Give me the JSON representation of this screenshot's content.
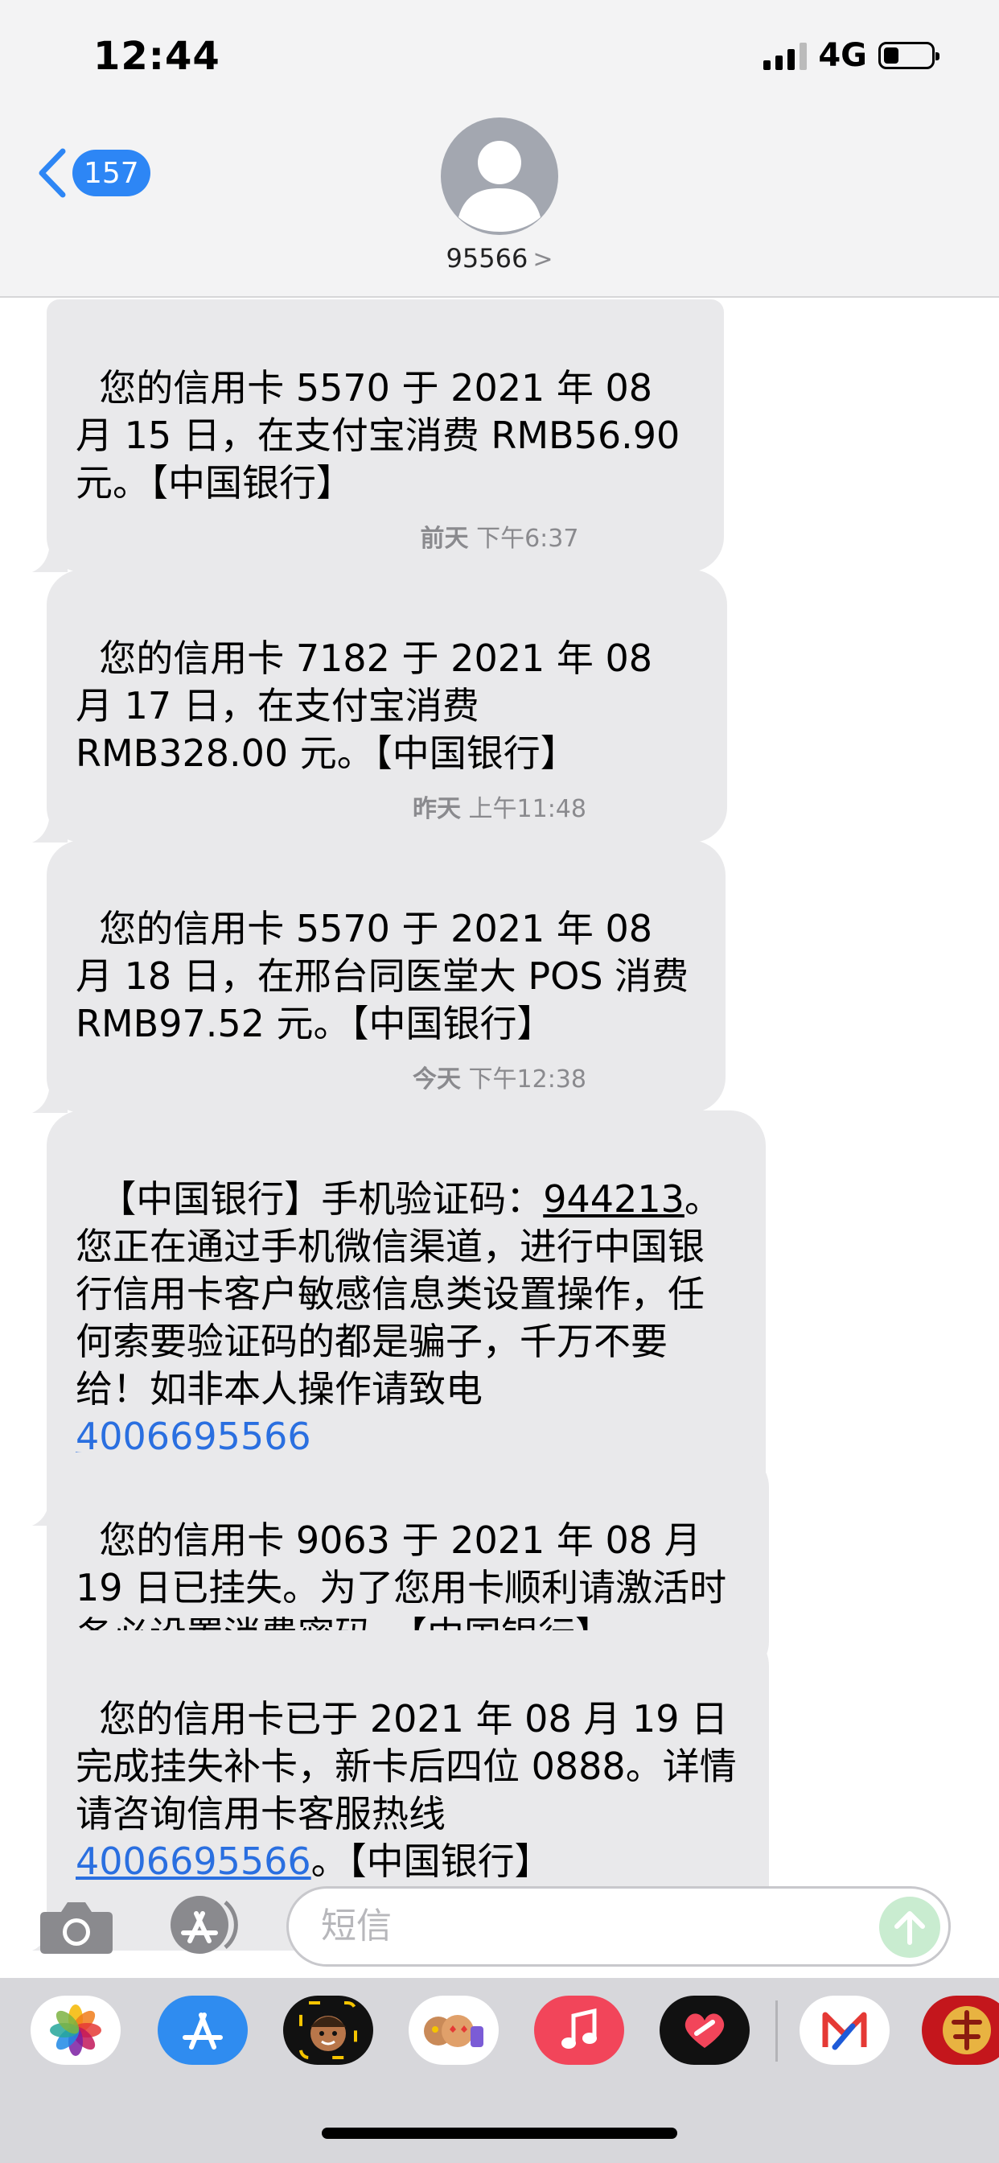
{
  "status": {
    "time": "12:44",
    "network": "4G"
  },
  "header": {
    "unread_count": "157",
    "contact": "95566",
    "contact_chevron": ">"
  },
  "messages": [
    {
      "type": "bubble",
      "text": "您的信用卡 5570 于 2021 年 08 月 15 日，在支付宝消费 RMB56.90 元。【中国银行】"
    },
    {
      "type": "time",
      "day": "前天",
      "time": "下午6:37"
    },
    {
      "type": "bubble",
      "text": "您的信用卡 7182 于 2021 年 08 月 17 日，在支付宝消费 RMB328.00 元。【中国银行】"
    },
    {
      "type": "time",
      "day": "昨天",
      "time": "上午11:48"
    },
    {
      "type": "bubble",
      "text": "您的信用卡 5570 于 2021 年 08 月 18 日，在邢台同医堂大 POS 消费 RMB97.52 元。【中国银行】"
    },
    {
      "type": "time",
      "day": "今天",
      "time": "下午12:38"
    },
    {
      "type": "bubble",
      "pre": "【中国银行】手机验证码：",
      "code": "944213",
      "mid": "。您正在通过手机微信渠道，进行中国银行信用卡客户敏感信息类设置操作，任何索要验证码的都是骗子，千万不要给！如非本人操作请致电",
      "phone": "4006695566"
    },
    {
      "type": "bubble",
      "text": "您的信用卡 9063 于 2021 年 08 月 19 日已挂失。为了您用卡顺利请激活时务必设置消费密码。【中国银行】"
    },
    {
      "type": "bubble",
      "pre": "您的信用卡已于 2021 年 08 月 19 日完成挂失补卡，新卡后四位 0888。详情请咨询信用卡客服热线",
      "phone": "4006695566",
      "post": "。【中国银行】"
    }
  ],
  "compose": {
    "placeholder": "短信"
  },
  "drawer": {
    "apps": [
      "photos-app",
      "app-store-app",
      "memoji-app",
      "animoji-app",
      "music-app",
      "heart-app",
      "bank-app",
      "game-app"
    ]
  },
  "colors": {
    "bubble": "#e9e9eb",
    "link": "#2a6fe0",
    "badge": "#2d86f5",
    "drawer": "#d7d7db"
  }
}
